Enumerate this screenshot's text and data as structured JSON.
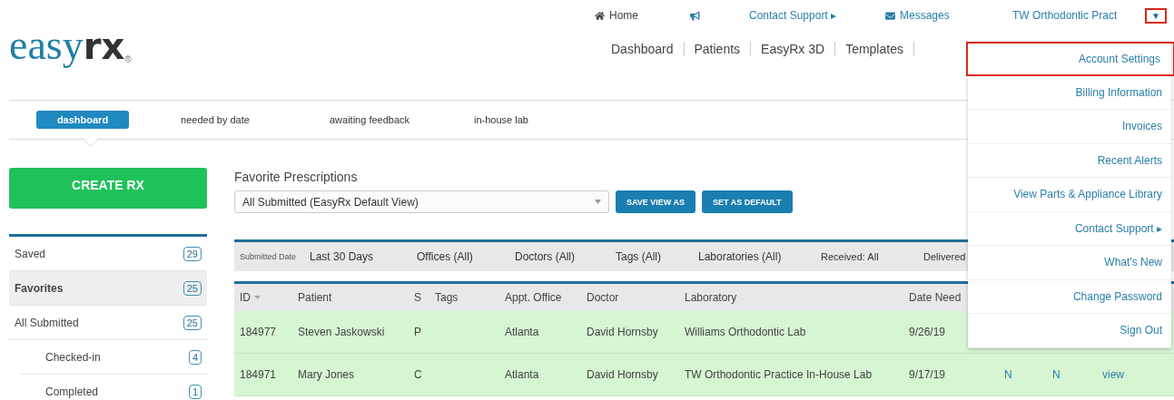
{
  "top_links": [
    {
      "kind": "home",
      "label": "Home"
    },
    {
      "kind": "megaphone"
    },
    {
      "kind": "support",
      "label": "Contact Support ▸"
    },
    {
      "kind": "messages",
      "label": "Messages"
    }
  ],
  "account": {
    "name": "TW Orthodontic Pract",
    "caret": "▼",
    "highlighted": true
  },
  "logo": {
    "main": "easy",
    "accent": "rx",
    "mark": "®"
  },
  "main_nav": [
    "Dashboard",
    "Patients",
    "EasyRx 3D",
    "Templates"
  ],
  "tabs": [
    {
      "label": "dashboard",
      "selected": true
    },
    {
      "label": "needed by date",
      "selected": false
    },
    {
      "label": "awaiting feedback",
      "selected": false
    },
    {
      "label": "in-house lab",
      "selected": false
    }
  ],
  "create_button": "CREATE RX",
  "sidebar": {
    "items": [
      {
        "label": "Saved",
        "count": "29",
        "selected": false
      },
      {
        "label": "Favorites",
        "count": "25",
        "selected": true
      },
      {
        "label": "All Submitted",
        "count": "25",
        "selected": false,
        "children": [
          {
            "label": "Checked-in",
            "count": "4",
            "selected": false
          },
          {
            "label": "Completed",
            "count": "1",
            "selected": false
          }
        ]
      }
    ]
  },
  "favorites": {
    "title": "Favorite Prescriptions",
    "view_select": {
      "value": "All Submitted (EasyRx Default View)"
    },
    "buttons": [
      "SAVE VIEW AS",
      "SET AS DEFAULT"
    ]
  },
  "filters": [
    {
      "kind": "label",
      "text": "Submitted Date"
    },
    {
      "kind": "filter",
      "text": "Last 30 Days"
    },
    {
      "kind": "filter",
      "text": "Offices (All)"
    },
    {
      "kind": "filter",
      "text": "Doctors (All)"
    },
    {
      "kind": "filter",
      "text": "Tags (All)"
    },
    {
      "kind": "filter",
      "text": "Laboratories (All)"
    },
    {
      "kind": "status",
      "text": "Received: All"
    },
    {
      "kind": "status",
      "text": "Delivered"
    }
  ],
  "table": {
    "columns": [
      {
        "label": "ID",
        "sorted": true
      },
      {
        "label": "Patient",
        "sorted": false
      },
      {
        "label": "S",
        "sorted": false
      },
      {
        "label": "Tags",
        "sorted": false
      },
      {
        "label": "Appt. Office",
        "sorted": false
      },
      {
        "label": "Doctor",
        "sorted": false
      },
      {
        "label": "Laboratory",
        "sorted": false
      },
      {
        "label": "Date Need",
        "sorted": false
      }
    ],
    "rows": [
      {
        "cells": [
          "184977",
          "Steven Jaskowski",
          "P",
          null,
          "Atlanta",
          "David Hornsby",
          "Williams Orthodontic Lab",
          "9/26/19"
        ]
      },
      {
        "cells": [
          "184971",
          "Mary Jones",
          "C",
          null,
          "Atlanta",
          "David Hornsby",
          "TW Orthodontic Practice In-House Lab",
          "9/17/19",
          "N",
          "N",
          "view"
        ]
      }
    ]
  },
  "menu": {
    "items": [
      {
        "label": "Account Settings",
        "highlighted": true
      },
      {
        "label": "Billing Information",
        "highlighted": false
      },
      {
        "label": "Invoices",
        "highlighted": false
      },
      {
        "label": "Recent Alerts",
        "highlighted": false
      },
      {
        "label": "View Parts & Appliance Library",
        "highlighted": false
      },
      {
        "label": "Contact Support ▸",
        "highlighted": false
      },
      {
        "label": "What's New",
        "highlighted": false
      },
      {
        "label": "Change Password",
        "highlighted": false
      },
      {
        "label": "Sign Out",
        "highlighted": false
      }
    ]
  }
}
